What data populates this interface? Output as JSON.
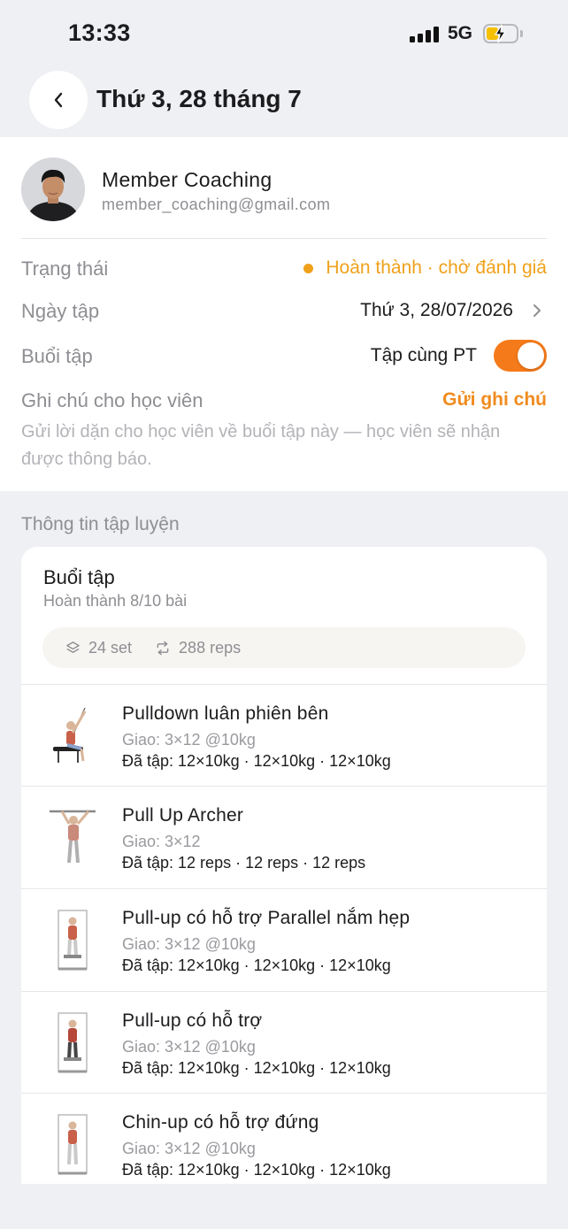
{
  "status_bar": {
    "time": "13:33",
    "network": "5G"
  },
  "header": {
    "title": "Thứ 3, 28 tháng 7"
  },
  "member": {
    "name": "Member Coaching",
    "email": "member_coaching@gmail.com"
  },
  "details": {
    "status_label": "Trạng thái",
    "status_value": "Hoàn thành · chờ đánh giá",
    "date_label": "Ngày tập",
    "date_value": "Thứ 3, 28/07/2026",
    "session_label": "Buổi tập",
    "session_value": "Tập cùng PT",
    "session_toggle_on": true,
    "note_label": "Ghi chú cho học viên",
    "note_action": "Gửi ghi chú",
    "note_description": "Gửi lời dặn cho học viên về buổi tập này — học viên sẽ nhận được thông báo."
  },
  "training": {
    "section_title": "Thông tin tập luyện",
    "card_title": "Buổi tập",
    "card_subtitle": "Hoàn thành 8/10 bài",
    "sets": "24 set",
    "reps": "288 reps",
    "exercises": [
      {
        "name": "Pulldown luân phiên bên",
        "plan": "Giao: 3×12 @10kg",
        "done": "Đã tập: 12×10kg  ·  12×10kg  ·  12×10kg"
      },
      {
        "name": "Pull Up Archer",
        "plan": "Giao: 3×12",
        "done": "Đã tập: 12 reps  ·  12 reps  ·  12 reps"
      },
      {
        "name": "Pull-up có hỗ trợ Parallel nắm hẹp",
        "plan": "Giao: 3×12 @10kg",
        "done": "Đã tập: 12×10kg  ·  12×10kg  ·  12×10kg"
      },
      {
        "name": "Pull-up có hỗ trợ",
        "plan": "Giao: 3×12 @10kg",
        "done": "Đã tập: 12×10kg  ·  12×10kg  ·  12×10kg"
      },
      {
        "name": "Chin-up có hỗ trợ đứng",
        "plan": "Giao: 3×12 @10kg",
        "done": "Đã tập: 12×10kg  ·  12×10kg  ·  12×10kg"
      }
    ]
  },
  "colors": {
    "accent": "#f57a1a",
    "status": "#f0a11b",
    "background": "#eff0f3"
  },
  "icons": [
    "chevron-left-icon",
    "chevron-right-icon",
    "layers-icon",
    "repeat-icon",
    "battery-charging-icon",
    "signal-icon"
  ]
}
